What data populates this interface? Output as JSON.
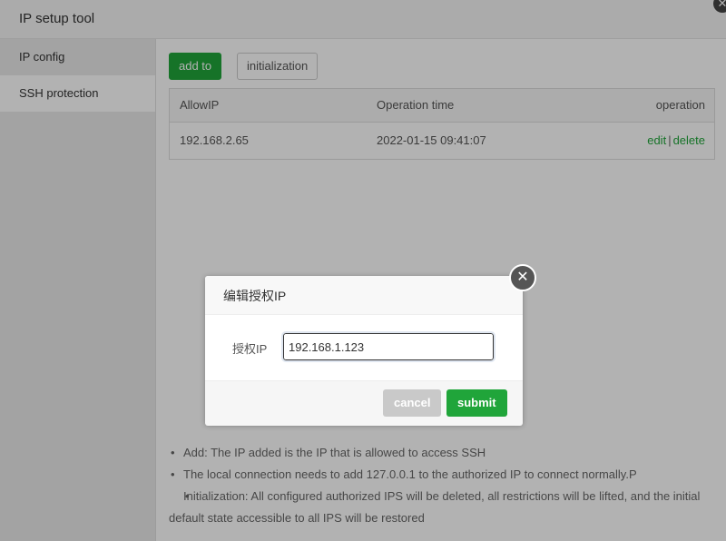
{
  "window": {
    "title": "IP setup tool",
    "close_glyph": "✕"
  },
  "sidebar": {
    "items": [
      {
        "label": "IP config"
      },
      {
        "label": "SSH protection"
      }
    ]
  },
  "toolbar": {
    "add_label": "add to",
    "init_label": "initialization"
  },
  "table": {
    "headers": [
      "AllowIP",
      "Operation time",
      "operation"
    ],
    "rows": [
      {
        "ip": "192.168.2.65",
        "time": "2022-01-15 09:41:07",
        "edit": "edit",
        "separator": "|",
        "delete": "delete"
      }
    ]
  },
  "notes": [
    "Add: The IP added is the IP that is allowed to access SSH",
    "The local connection needs to add 127.0.0.1 to the authorized IP to connect normally.P",
    "Initialization: All configured authorized IPS will be deleted, all restrictions will be lifted, and the initial default state accessible to all IPS will be restored"
  ],
  "modal": {
    "title": "编辑授权IP",
    "close_glyph": "✕",
    "field_label": "授权IP",
    "field_value": "192.168.1.123",
    "cancel_label": "cancel",
    "submit_label": "submit"
  },
  "colors": {
    "accent": "#20a53a",
    "overlay": "rgba(0,0,0,0.3)"
  },
  "icons": {
    "window_close": "close-icon",
    "modal_close": "close-circle-icon"
  }
}
